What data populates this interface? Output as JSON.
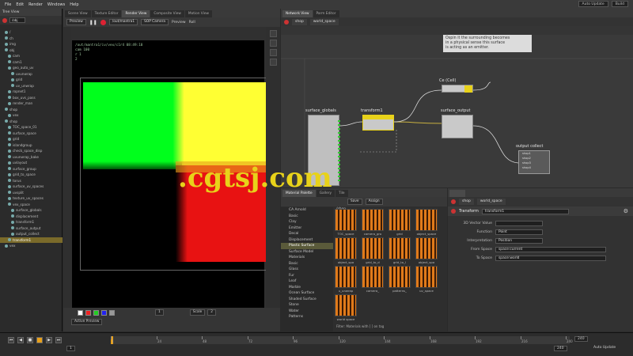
{
  "menu": {
    "items": [
      "File",
      "Edit",
      "Render",
      "Windows",
      "Help"
    ],
    "auto_update": "Auto Update",
    "build": "Build"
  },
  "tree": {
    "tab": "Tree View",
    "path": "/obj",
    "rows": [
      "/",
      "ch",
      "img",
      "obj",
      "cam",
      "cam1",
      "geo_auto_uv",
      "uvunwrap",
      "grid",
      "uv_unwrap",
      "ropnet1",
      "box_uvs_pass",
      "render_man",
      "shop",
      "vex",
      "shop",
      "TOC_space_01",
      "surface_space",
      "grid",
      "islandgroup",
      "check_space_disp",
      "uvunwrap_bake",
      "uvlayout",
      "surface_group",
      "grid_to_space",
      "torus",
      "surface_uv_spaces",
      "uvsplit",
      "texture_uv_spaces",
      "vex_space",
      "surface_globals",
      "displacement",
      "transform1",
      "surface_output",
      "output_collect",
      "transform1",
      "vex"
    ]
  },
  "viewer": {
    "tabs": [
      "Scene View",
      "Texture Editor",
      "Render View",
      "Composite View",
      "Motion View"
    ],
    "toolbar": {
      "preview": "Preview",
      "renderer": "/out/mantra1",
      "camera": "SOP Camera",
      "preview_check": "Preview",
      "render_label": "Roll"
    },
    "info": [
      "/out/mantra1/iv/vex/c1r4 08:49:10",
      "cam 100",
      "r 1",
      "2"
    ],
    "bottom": {
      "layer": "Active Preview",
      "frame": "1",
      "scale": "Scale",
      "zoom": "2"
    }
  },
  "network": {
    "tabs": [
      "Network View",
      "Parm Editor"
    ],
    "path": [
      "shop",
      "world_space"
    ],
    "note": [
      "Ospin it the surrounding becomes",
      "in a physical sense this surface",
      "is acting as an emitter."
    ],
    "nodes": {
      "ce": "Ce (Cell)",
      "globals": "surface_globals",
      "transform": "transform1",
      "output": "surface_output",
      "collect": "output collect"
    },
    "collect_ports": [
      "shop1",
      "shop2",
      "shop3",
      "shop4"
    ]
  },
  "material": {
    "tabs": [
      "Material Palette",
      "Gallery",
      "Tile"
    ],
    "toolbar": [
      "Save",
      "Assign"
    ],
    "path": "/shop",
    "categories": [
      "CA Arnold",
      "Basic",
      "Clay",
      "Emitter",
      "Decal",
      "Displacement",
      "Plastic Surface",
      "Surface Model",
      "Materials",
      "Basic",
      "Glass",
      "Fur",
      "Leaf",
      "Marble",
      "Ocean Surface",
      "Shaded Surface",
      "Stone",
      "Water",
      "Patterns"
    ],
    "selected": "Plastic Surface",
    "thumbs": [
      "TOC_space",
      "camera_gro",
      "grid",
      "object_space",
      "object_spa",
      "grid_to_d",
      "grid_to_l",
      "object_spa",
      "u_unwrap",
      "camera_",
      "patterns_",
      "uv_space",
      "world space"
    ],
    "status": "Filter: Materials with [ ] on tag"
  },
  "params": {
    "path": [
      "shop",
      "world_space"
    ],
    "node_type": "Transform",
    "node_name": "transform1",
    "fields": [
      {
        "label": "3D Vector Value",
        "value": ""
      },
      {
        "label": "Function",
        "value": "Point"
      },
      {
        "label": "Interpretation",
        "value": "Position"
      },
      {
        "label": "From Space",
        "value": "space:current"
      },
      {
        "label": "To Space",
        "value": "space:world"
      }
    ]
  },
  "timeline": {
    "ticks": [
      "1",
      "24",
      "48",
      "72",
      "96",
      "120",
      "144",
      "168",
      "192",
      "216",
      "240"
    ],
    "start": "1",
    "end": "240",
    "frame": "1",
    "end_field": "240",
    "auto_update": "Auto Update"
  },
  "colors": {
    "accent": "#e8d21a",
    "selected": "#7a6a2a",
    "green": "#00ff1c",
    "yellow": "#ffff33",
    "red": "#e81212"
  },
  "watermark": ".cgtsj.com"
}
